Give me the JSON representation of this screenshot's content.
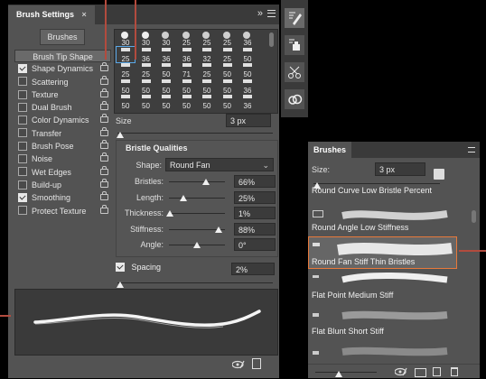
{
  "brush_settings": {
    "tab_title": "Brush Settings",
    "collapse_icon": "double-chevron-right-icon",
    "menu_icon": "panel-menu-icon",
    "brushes_button": "Brushes",
    "options": [
      {
        "label": "Brush Tip Shape",
        "checkbox": false,
        "selected": true
      },
      {
        "label": "Shape Dynamics",
        "checked": true,
        "lock": true
      },
      {
        "label": "Scattering",
        "checked": false,
        "lock": true
      },
      {
        "label": "Texture",
        "checked": false,
        "lock": true
      },
      {
        "label": "Dual Brush",
        "checked": false,
        "lock": true
      },
      {
        "label": "Color Dynamics",
        "checked": false,
        "lock": true
      },
      {
        "label": "Transfer",
        "checked": false,
        "lock": true
      },
      {
        "label": "Brush Pose",
        "checked": false,
        "lock": true
      },
      {
        "label": "Noise",
        "checked": false,
        "lock": true
      },
      {
        "label": "Wet Edges",
        "checked": false,
        "lock": true
      },
      {
        "label": "Build-up",
        "checked": false,
        "lock": true
      },
      {
        "label": "Smoothing",
        "checked": true,
        "lock": true
      },
      {
        "label": "Protect Texture",
        "checked": false,
        "lock": true
      }
    ],
    "tip_rows": [
      [
        "30",
        "30",
        "30",
        "25",
        "25",
        "25",
        "36"
      ],
      [
        "25",
        "36",
        "36",
        "36",
        "32",
        "25",
        "50"
      ],
      [
        "25",
        "25",
        "50",
        "71",
        "25",
        "50",
        "50"
      ],
      [
        "50",
        "50",
        "50",
        "50",
        "50",
        "50",
        "36"
      ],
      [
        "50",
        "50",
        "50",
        "50",
        "50",
        "50",
        "36"
      ]
    ],
    "size_label": "Size",
    "size_value": "3 px",
    "size_level": 0.02,
    "bristle_heading": "Bristle Qualities",
    "shape_label": "Shape:",
    "shape_value": "Round Fan",
    "bristle_params": [
      {
        "label": "Bristles:",
        "value": "66%",
        "level": 0.66
      },
      {
        "label": "Length:",
        "value": "25%",
        "level": 0.25
      },
      {
        "label": "Thickness:",
        "value": "1%",
        "level": 0.01
      },
      {
        "label": "Stiffness:",
        "value": "88%",
        "level": 0.88
      },
      {
        "label": "Angle:",
        "value": "0°",
        "level": 0.5
      }
    ],
    "spacing_label": "Spacing",
    "spacing_checked": true,
    "spacing_value": "2%",
    "spacing_level": 0.02
  },
  "toolbar_icons": [
    "brush-settings-icon",
    "clone-source-icon",
    "scissors-icon",
    "creative-cloud-icon"
  ],
  "brushes_panel": {
    "tab_title": "Brushes",
    "size_label": "Size:",
    "size_value": "3 px",
    "items": [
      {
        "label": "Round Curve Low Bristle Percent",
        "selected": false
      },
      {
        "label": "Round Angle Low Stiffness",
        "selected": false
      },
      {
        "label": "Round Fan Stiff Thin Bristles",
        "selected": true
      },
      {
        "label": "Flat Point Medium Stiff",
        "selected": false
      },
      {
        "label": "Flat Blunt Short Stiff",
        "selected": false
      }
    ],
    "footer_icons": [
      "eye-preview-icon",
      "new-group-folder-icon",
      "new-brush-icon",
      "trash-icon"
    ]
  },
  "colors": {
    "panel": "#535353",
    "accent_red": "#b24b3e",
    "selection_orange": "#e8793b",
    "selected_row": "#666666"
  }
}
